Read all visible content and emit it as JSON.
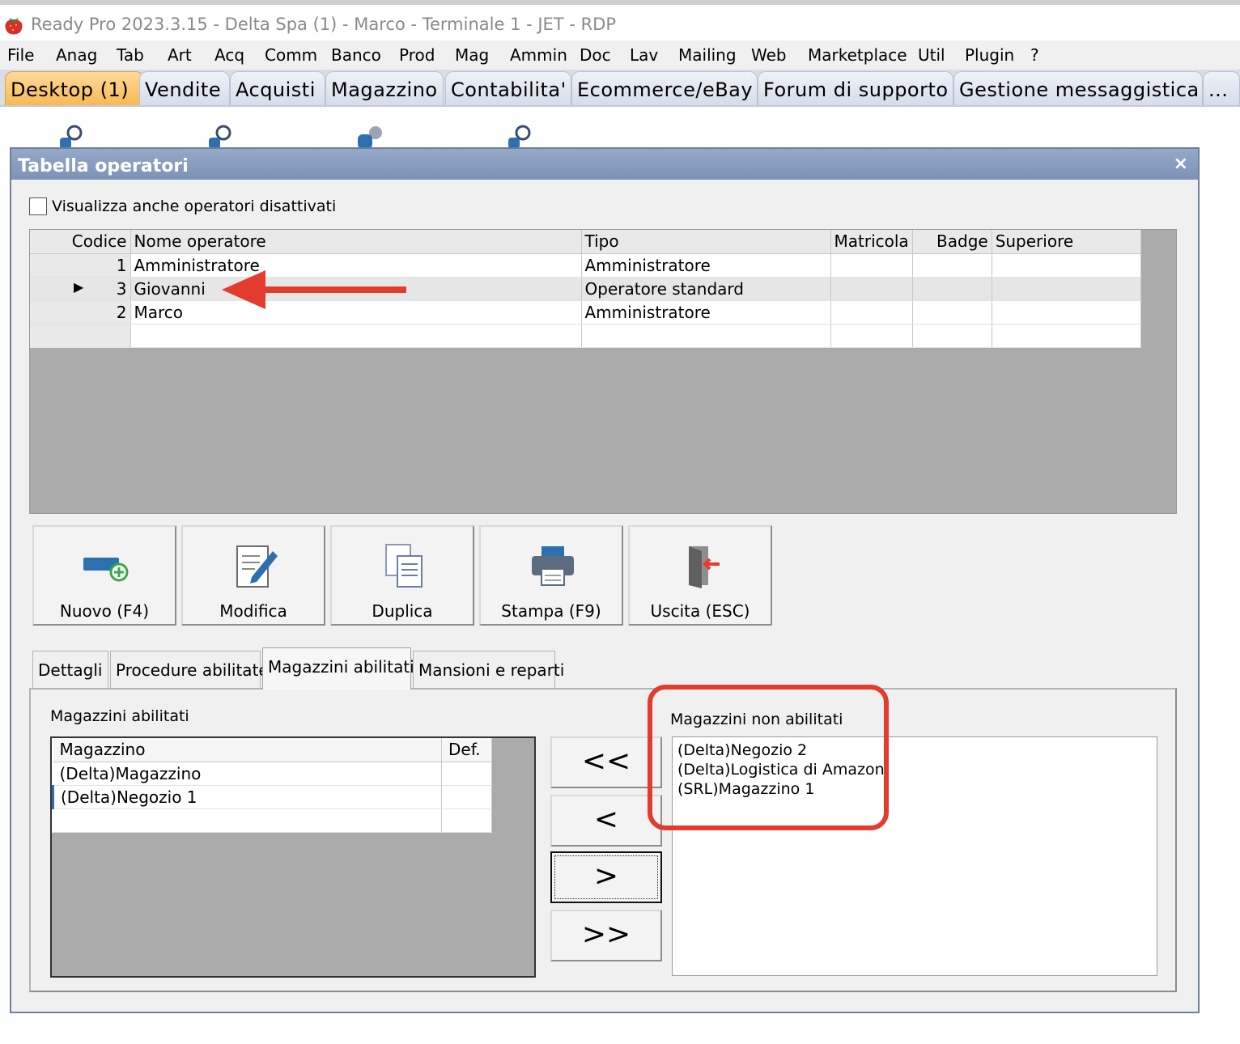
{
  "window": {
    "title": "Ready Pro 2023.3.15 - Delta Spa (1) - Marco - Terminale 1 - JET - RDP"
  },
  "menu": [
    "File",
    "Anag",
    "Tab",
    "Art",
    "Acq",
    "Comm",
    "Banco",
    "Prod",
    "Mag",
    "Ammin",
    "Doc",
    "Lav",
    "Mailing",
    "Web",
    "Marketplace",
    "Util",
    "Plugin",
    "?"
  ],
  "tabs": [
    "Desktop (1)",
    "Vendite",
    "Acquisti",
    "Magazzino",
    "Contabilita'",
    "Ecommerce/eBay",
    "Forum di supporto",
    "Gestione messaggistica",
    "..."
  ],
  "dialog": {
    "title": "Tabella operatori",
    "close_label": "×",
    "show_inactive_label": "Visualizza anche operatori disattivati",
    "columns": [
      "Codice",
      "Nome operatore",
      "Tipo",
      "Matricola",
      "Badge",
      "Superiore"
    ],
    "rows": [
      {
        "code": "1",
        "name": "Amministratore",
        "type": "Amministratore"
      },
      {
        "code": "3",
        "name": "Giovanni",
        "type": "Operatore standard"
      },
      {
        "code": "2",
        "name": "Marco",
        "type": "Amministratore"
      }
    ],
    "selected_row_marker": "▶",
    "buttons": {
      "new": "Nuovo (F4)",
      "edit": "Modifica",
      "duplicate": "Duplica",
      "print": "Stampa (F9)",
      "exit": "Uscita (ESC)"
    },
    "lower_tabs": [
      "Dettagli",
      "Procedure abilitate",
      "Magazzini abilitati",
      "Mansioni e reparti"
    ],
    "enabled": {
      "label": "Magazzini abilitati",
      "columns": [
        "Magazzino",
        "Def."
      ],
      "rows": [
        "(Delta)Magazzino",
        "(Delta)Negozio 1"
      ]
    },
    "move_buttons": [
      "<<",
      "<",
      ">",
      ">>"
    ],
    "disabled": {
      "label": "Magazzini non abilitati",
      "items": [
        "(Delta)Negozio 2",
        "(Delta)Logistica di Amazon",
        "(SRL)Magazzino 1"
      ]
    }
  },
  "colors": {
    "accent_tab": "#f6b955",
    "annotation": "#e33b2e",
    "dialog_title": "#7c93b6"
  }
}
